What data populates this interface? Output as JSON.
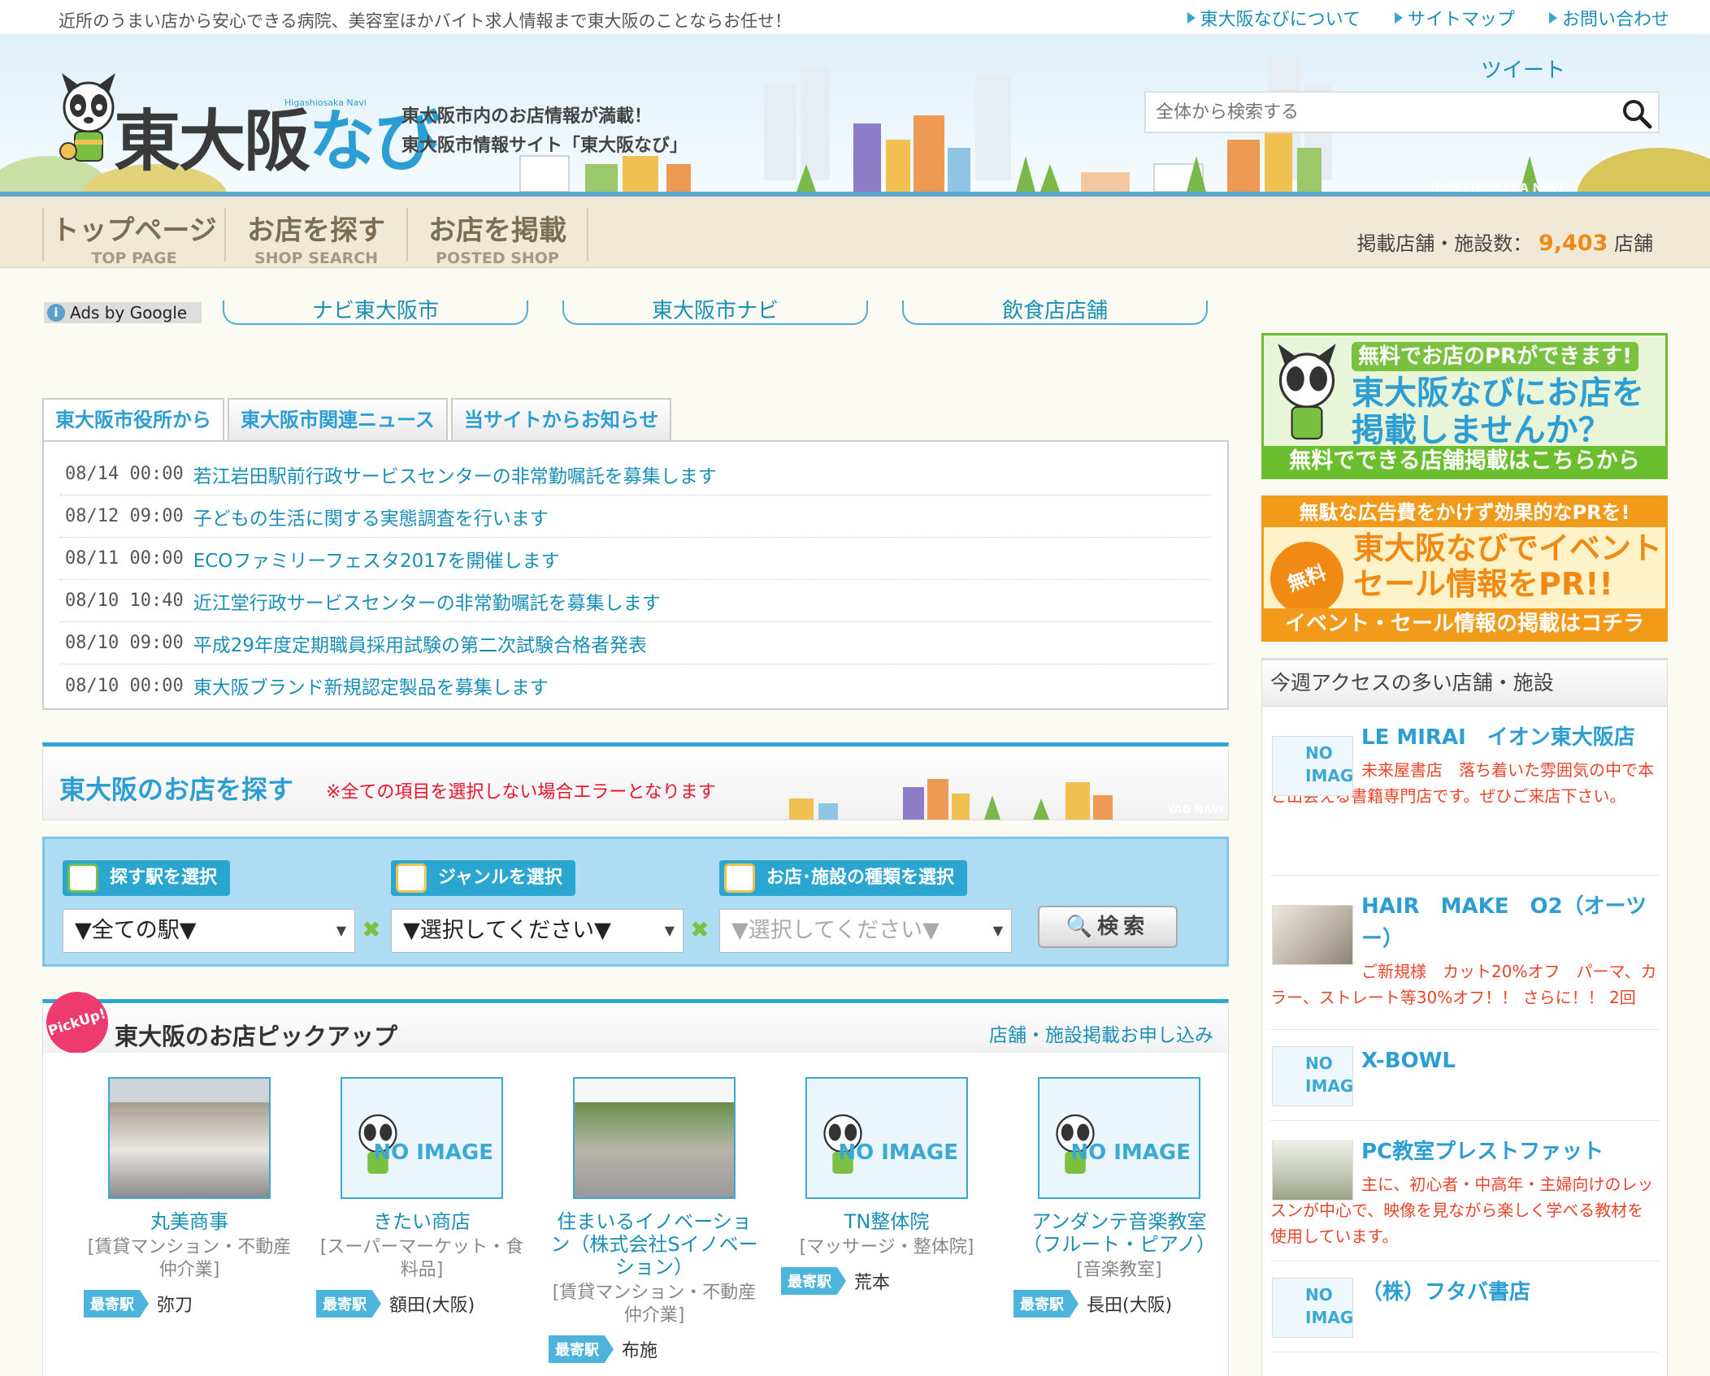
{
  "topstrip": {
    "tagline": "近所のうまい店から安心できる病院、美容室ほかバイト求人情報まで東大阪のことならお任せ！",
    "links": [
      "東大阪なびについて",
      "サイトマップ",
      "お問い合わせ"
    ]
  },
  "header": {
    "logo_main": "東大阪",
    "logo_nabi": "なび",
    "logo_sub": "Higashiosaka Navi",
    "catch_line1": "東大阪市内のお店情報が満載！",
    "catch_line2": "東大阪市情報サイト「東大阪なび」",
    "tweet": "ツイート",
    "search_placeholder": "全体から検索する",
    "banner_tag": "HIGASHIOSAKA NAVI"
  },
  "nav": {
    "items": [
      {
        "jp": "トップページ",
        "en": "TOP PAGE"
      },
      {
        "jp": "お店を探す",
        "en": "SHOP SEARCH"
      },
      {
        "jp": "お店を掲載",
        "en": "POSTED SHOP"
      }
    ],
    "count_label": "掲載店舗・施設数：",
    "count_value": "9,403",
    "count_unit": "店舗"
  },
  "ads": {
    "label": "Ads by Google",
    "links": [
      "ナビ東大阪市",
      "東大阪市ナビ",
      "飲食店店舗"
    ]
  },
  "news": {
    "tabs": [
      "東大阪市役所から",
      "東大阪市関連ニュース",
      "当サイトからお知らせ"
    ],
    "items": [
      {
        "date": "08/14 00:00",
        "title": "若江岩田駅前行政サービスセンターの非常勤嘱託を募集します"
      },
      {
        "date": "08/12 09:00",
        "title": "子どもの生活に関する実態調査を行います"
      },
      {
        "date": "08/11 00:00",
        "title": "ECOファミリーフェスタ2017を開催します"
      },
      {
        "date": "08/10 10:40",
        "title": "近江堂行政サービスセンターの非常勤嘱託を募集します"
      },
      {
        "date": "08/10 09:00",
        "title": "平成29年度定期職員採用試験の第二次試験合格者発表"
      },
      {
        "date": "08/10 00:00",
        "title": "東大阪ブランド新規認定製品を募集します"
      }
    ]
  },
  "shop_search": {
    "title": "東大阪のお店を探す",
    "warning": "※全ての項目を選択しない場合エラーとなります",
    "tag": "YAO NAVI",
    "label_station": "探す駅を選択",
    "label_genre": "ジャンルを選択",
    "label_type": "お店･施設の種類を選択",
    "select_station": "▼全ての駅▼",
    "select_genre": "▼選択してください▼",
    "select_type": "▼選択してください▼",
    "search_button": "検索"
  },
  "pickup": {
    "badge": "PickUp!",
    "title": "東大阪のお店ピックアップ",
    "apply_link": "店舗・施設掲載お申し込み",
    "station_label": "最寄駅",
    "noimage": "NO IMAGE",
    "cards": [
      {
        "name": "丸美商事",
        "category": "[賃貸マンション・不動産仲介業]",
        "station": "弥刀"
      },
      {
        "name": "きたい商店",
        "category": "[スーパーマーケット・食料品]",
        "station": "額田(大阪)"
      },
      {
        "name": "住まいるイノベーション（株式会社Sイノベーション）",
        "category": "[賃貸マンション・不動産仲介業]",
        "station": "布施"
      },
      {
        "name": "TN整体院",
        "category": "[マッサージ・整体院]",
        "station": "荒本"
      },
      {
        "name": "アンダンテ音楽教室（フルート・ピアノ）",
        "category": "[音楽教室]",
        "station": "長田(大阪)"
      }
    ]
  },
  "sidebar": {
    "banner1_top": "無料でお店のPRができます!",
    "banner1_main": "東大阪なびにお店を掲載しませんか？",
    "banner1_bottom": "無料でできる店舗掲載はこちらから",
    "banner2_top": "無駄な広告費をかけず効果的なPRを!",
    "banner2_free": "無料",
    "banner2_main": "東大阪なびでイベントセール情報をPR!!",
    "banner2_bottom": "イベント・セール情報の掲載はコチラ",
    "ranking_title": "今週アクセスの多い店舗・施設",
    "ranking": [
      {
        "name": "LE MIRAI　イオン東大阪店",
        "desc": "未来屋書店　落ち着いた雰囲気の中で本と出会える書籍専門店です。ぜひご来店下さい。",
        "noimage": true
      },
      {
        "name": "HAIR　MAKE　O2（オーツー）",
        "desc": "ご新規様　カット20%オフ　パーマ、カラー、ストレート等30%オフ！！ さらに！！ 2回",
        "noimage": false
      },
      {
        "name": "X-BOWL",
        "desc": "",
        "noimage": true
      },
      {
        "name": "PC教室プレストファット",
        "desc": "主に、初心者・中高年・主婦向けのレッスンが中心で、映像を見ながら楽しく学べる教材を使用しています。",
        "noimage": false
      },
      {
        "name": "（株）フタバ書店",
        "desc": "",
        "noimage": true
      }
    ]
  },
  "colors": {
    "accent": "#2aa6d0",
    "link": "#1a8fb5",
    "warning": "#e8132b",
    "count": "#f08a14",
    "nav_bg": "#efe9d6"
  }
}
